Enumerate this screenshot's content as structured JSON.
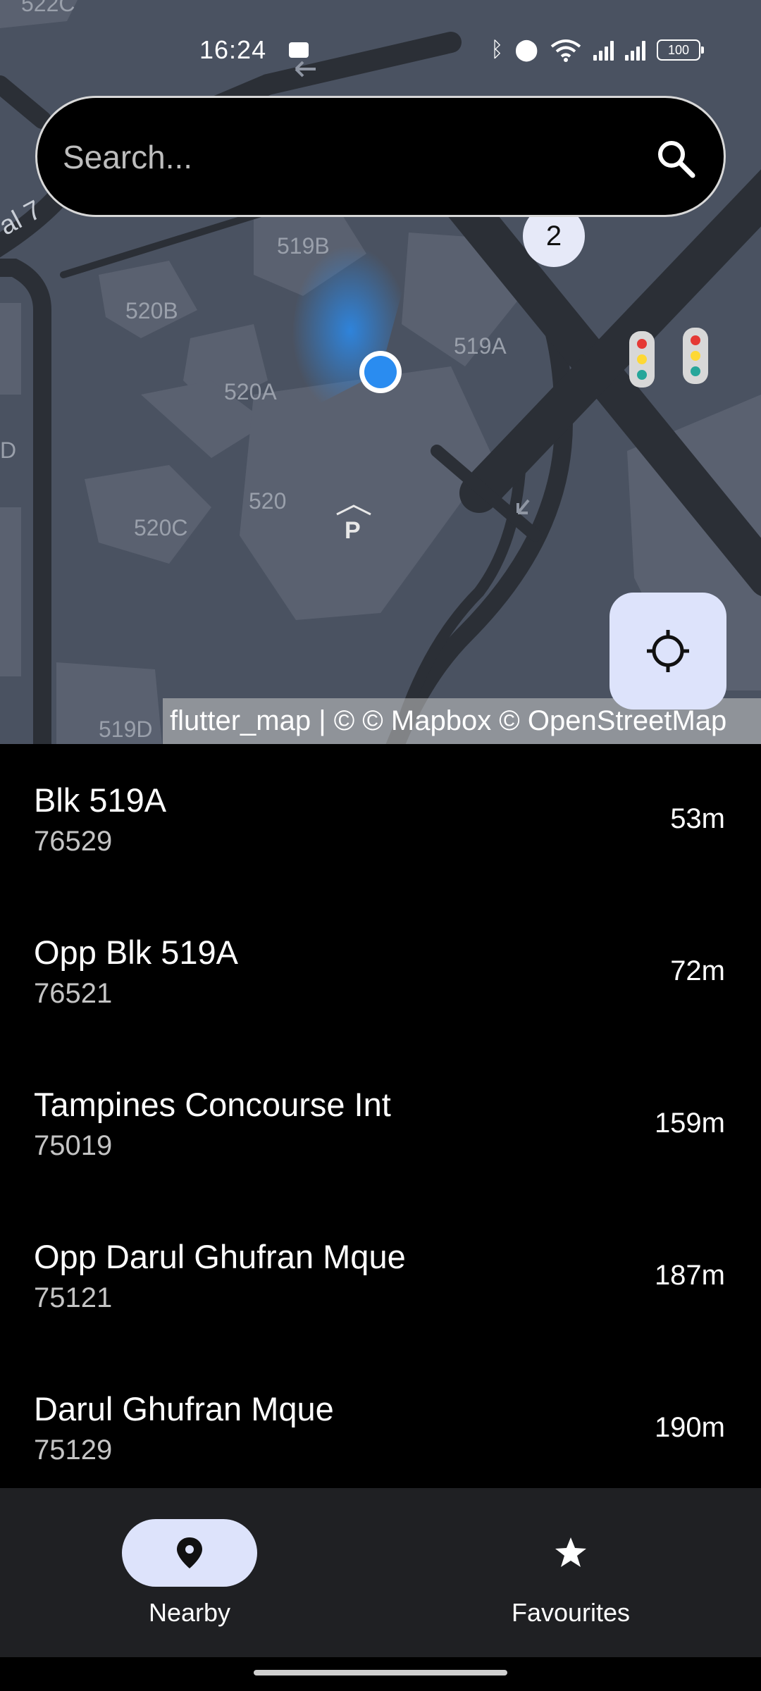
{
  "status_bar": {
    "time": "16:24",
    "battery": "100"
  },
  "search": {
    "placeholder": "Search...",
    "icon": "search-icon"
  },
  "map": {
    "cluster_count": "2",
    "labels": [
      "522C",
      "519B",
      "520B",
      "519A",
      "520A",
      "520",
      "520C",
      "519D",
      "al 7",
      "D"
    ],
    "attribution": "flutter_map | © © Mapbox © OpenStreetMap",
    "locate_icon": "crosshair-icon",
    "colors": {
      "background": "#4a5261",
      "road": "#2b2f36",
      "building": "#5a6170",
      "location_dot": "#2a8cf0"
    }
  },
  "stops": [
    {
      "name": "Blk 519A",
      "code": "76529",
      "distance": "53m"
    },
    {
      "name": "Opp Blk 519A",
      "code": "76521",
      "distance": "72m"
    },
    {
      "name": "Tampines Concourse Int",
      "code": "75019",
      "distance": "159m"
    },
    {
      "name": "Opp Darul Ghufran Mque",
      "code": "75121",
      "distance": "187m"
    },
    {
      "name": "Darul Ghufran Mque",
      "code": "75129",
      "distance": "190m"
    }
  ],
  "bottom_nav": {
    "items": [
      {
        "label": "Nearby",
        "icon": "map-pin-icon",
        "selected": true
      },
      {
        "label": "Favourites",
        "icon": "star-icon",
        "selected": false
      }
    ],
    "accent": "#dde3fb"
  }
}
